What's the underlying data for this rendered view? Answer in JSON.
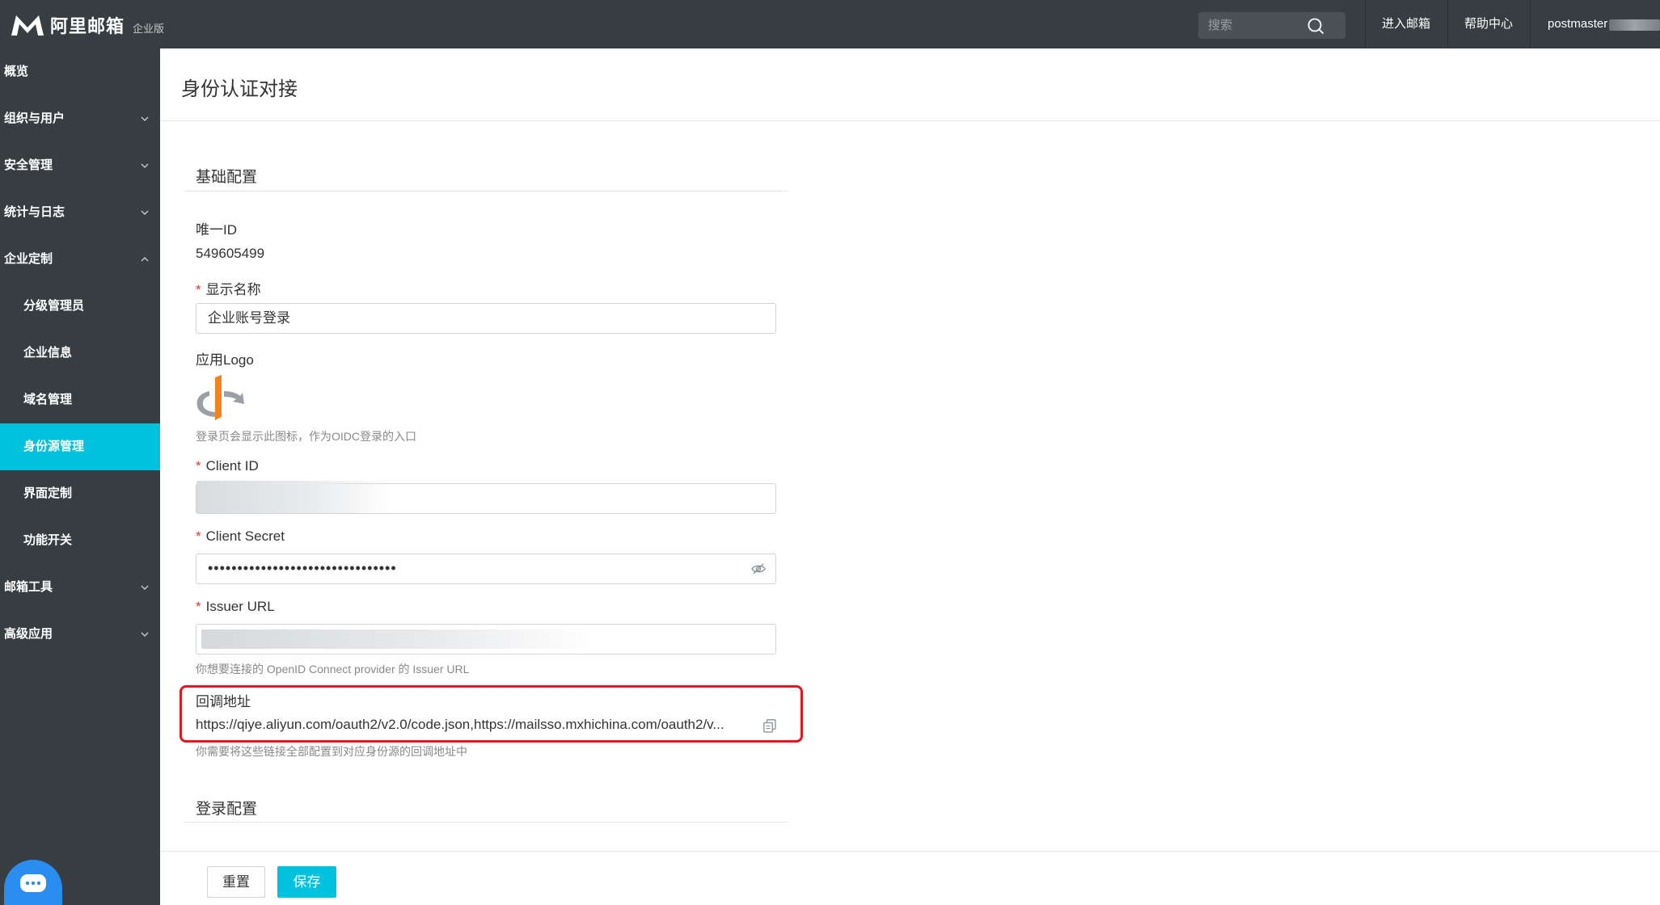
{
  "header": {
    "logo_text": "阿里邮箱",
    "edition": "企业版",
    "search_placeholder": "搜索",
    "nav": [
      "进入邮箱",
      "帮助中心"
    ],
    "user": "postmaster"
  },
  "sidebar": {
    "items": [
      {
        "label": "概览",
        "level": 1
      },
      {
        "label": "组织与用户",
        "level": 1,
        "chevron": "down"
      },
      {
        "label": "安全管理",
        "level": 1,
        "chevron": "down"
      },
      {
        "label": "统计与日志",
        "level": 1,
        "chevron": "down"
      },
      {
        "label": "企业定制",
        "level": 1,
        "chevron": "up"
      },
      {
        "label": "分级管理员",
        "level": 2
      },
      {
        "label": "企业信息",
        "level": 2
      },
      {
        "label": "域名管理",
        "level": 2
      },
      {
        "label": "身份源管理",
        "level": 2,
        "active": true
      },
      {
        "label": "界面定制",
        "level": 2
      },
      {
        "label": "功能开关",
        "level": 2
      },
      {
        "label": "邮箱工具",
        "level": 1,
        "chevron": "down"
      },
      {
        "label": "高级应用",
        "level": 1,
        "chevron": "down"
      }
    ],
    "active_color": "#00c1de"
  },
  "page": {
    "title": "身份认证对接"
  },
  "basic": {
    "section_title": "基础配置",
    "unique_id_label": "唯一ID",
    "unique_id_value": "549605499",
    "display_name_label": "显示名称",
    "display_name_value": "企业账号登录",
    "app_logo_label": "应用Logo",
    "app_logo_hint": "登录页会显示此图标，作为OIDC登录的入口",
    "client_id_label": "Client ID",
    "client_secret_label": "Client Secret",
    "client_secret_value": "••••••••••••••••••••••••••••••••",
    "issuer_url_label": "Issuer URL",
    "issuer_url_hint": "你想要连接的 OpenID Connect provider 的 Issuer URL",
    "callback_label": "回调地址",
    "callback_value": "https://qiye.aliyun.com/oauth2/v2.0/code.json,https://mailsso.mxhichina.com/oauth2/v...",
    "callback_hint": "你需要将这些链接全部配置到对应身份源的回调地址中"
  },
  "login": {
    "section_title": "登录配置"
  },
  "footer": {
    "reset_label": "重置",
    "save_label": "保存"
  },
  "colors": {
    "topbar": "#373d41",
    "accent": "#00c1de",
    "highlight": "#e3151e"
  }
}
